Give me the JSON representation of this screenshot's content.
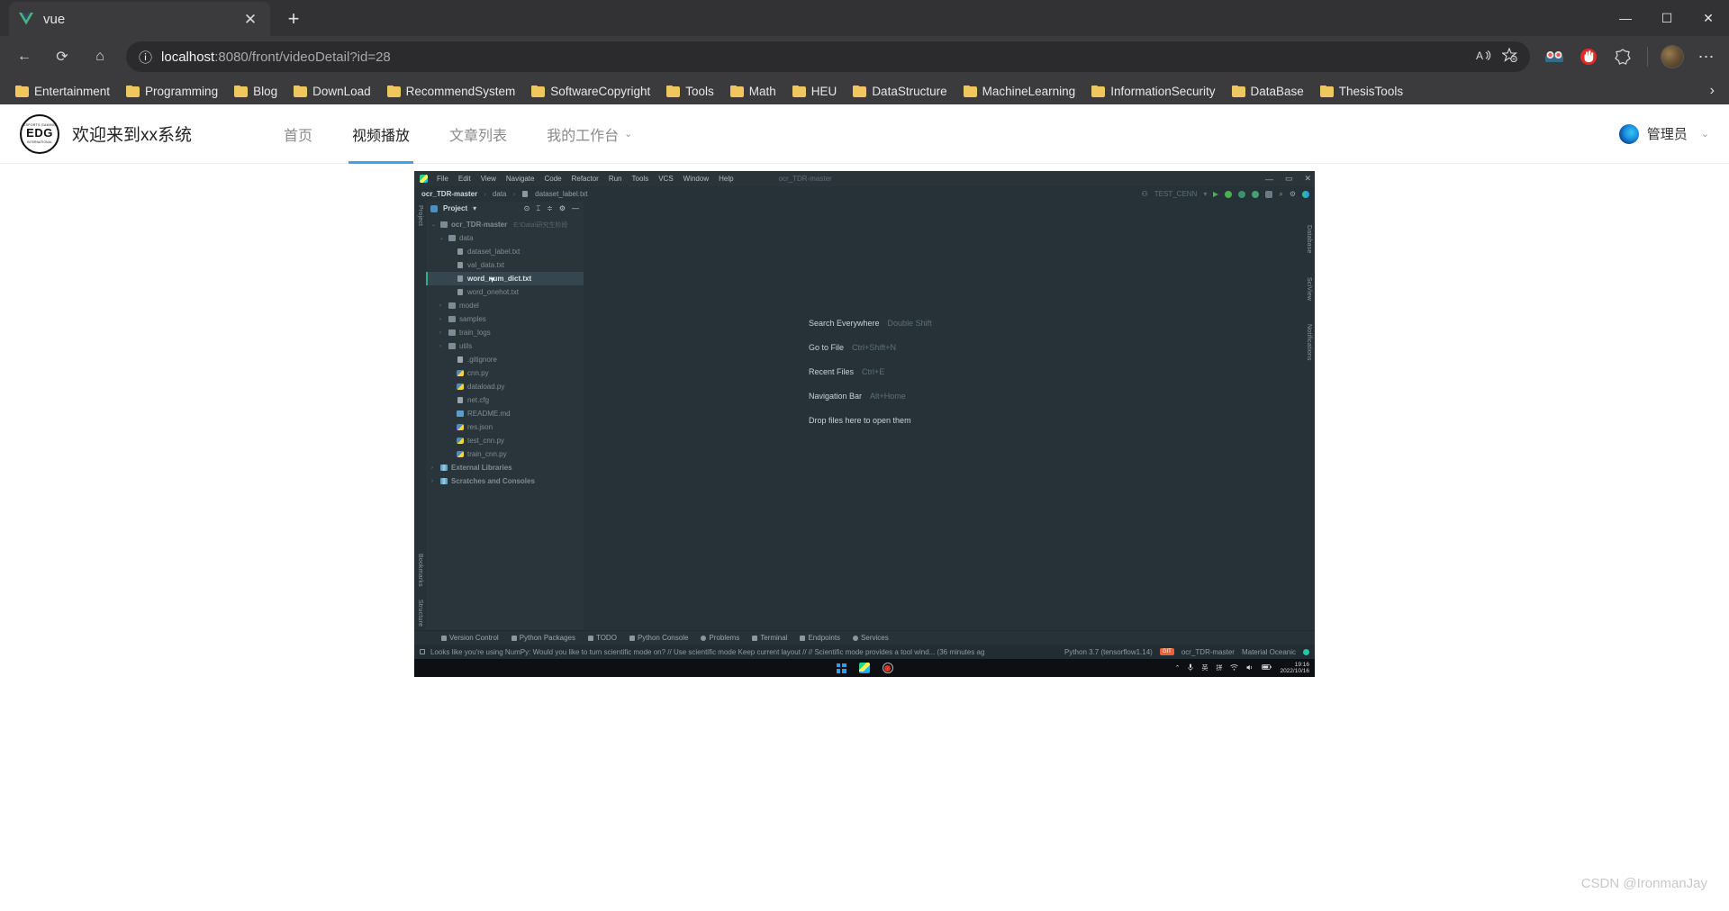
{
  "browser": {
    "tab": {
      "title": "vue",
      "favicon": "vue-logo-icon",
      "close_label": "✕"
    },
    "new_tab_label": "+",
    "window_controls": {
      "minimize": "—",
      "maximize": "☐",
      "close": "✕"
    },
    "nav": {
      "back": "←",
      "refresh": "⟳",
      "home": "⌂"
    },
    "omnibox": {
      "info_icon": "ⓘ",
      "url_host": "localhost",
      "url_path": ":8080/front/videoDetail?id=28",
      "read_aloud": "A",
      "favorite": "☆"
    },
    "toolbar_icons": [
      "glasses-extension-icon",
      "ublock-extension-icon",
      "collections-icon"
    ],
    "settings_more": "⋯",
    "bookmarks": [
      "Entertainment",
      "Programming",
      "Blog",
      "DownLoad",
      "RecommendSystem",
      "SoftwareCopyright",
      "Tools",
      "Math",
      "HEU",
      "DataStructure",
      "MachineLearning",
      "InformationSecurity",
      "DataBase",
      "ThesisTools"
    ],
    "bookmarks_overflow": "›"
  },
  "site": {
    "logo": {
      "top": "ESPORTS GAMING",
      "main": "EDG",
      "bottom": "INTERNATIONAL"
    },
    "title": "欢迎来到xx系统",
    "nav": [
      {
        "label": "首页",
        "active": false,
        "caret": ""
      },
      {
        "label": "视频播放",
        "active": true,
        "caret": ""
      },
      {
        "label": "文章列表",
        "active": false,
        "caret": ""
      },
      {
        "label": "我的工作台",
        "active": false,
        "caret": "⌄"
      }
    ],
    "user": {
      "name": "管理员",
      "caret": "⌄"
    }
  },
  "ide": {
    "app_icon": "pycharm-icon",
    "menus": [
      "File",
      "Edit",
      "View",
      "Navigate",
      "Code",
      "Refactor",
      "Run",
      "Tools",
      "VCS",
      "Window",
      "Help"
    ],
    "project_title": "ocr_TDR-master",
    "window_controls": {
      "minimize": "—",
      "maximize": "▭",
      "close": "✕"
    },
    "breadcrumb": {
      "root": "ocr_TDR-master",
      "sep": "›",
      "folder": "data",
      "file": "dataset_label.txt"
    },
    "toolbar": {
      "profile": "⚇",
      "run_config": "TEST_CENN",
      "dropdown": "▾",
      "run": "▶",
      "debug": "debug-icon",
      "coverage": "coverage-icon",
      "profile_run": "profiler-icon",
      "stop": "■",
      "search": "⌕",
      "settings": "⚙",
      "updates": "updates-icon"
    },
    "left_strip": {
      "top": "Project",
      "bookmarks": "Bookmarks",
      "structure": "Structure"
    },
    "right_strip": [
      "Database",
      "SciView",
      "Notifications"
    ],
    "panel": {
      "title": "Project",
      "dropdown": "▾",
      "icons": [
        "locate-icon",
        "collapse-icon",
        "sort-icon",
        "gear-icon",
        "hide-icon"
      ]
    },
    "tree": [
      {
        "depth": 0,
        "arrow": "⌄",
        "icon": "dir",
        "label": "ocr_TDR-master",
        "path": "E:\\Data\\研究生阶段",
        "selected": false
      },
      {
        "depth": 1,
        "arrow": "⌄",
        "icon": "dir",
        "label": "data",
        "path": "",
        "selected": false
      },
      {
        "depth": 2,
        "arrow": "",
        "icon": "txt",
        "label": "dataset_label.txt",
        "path": "",
        "selected": false
      },
      {
        "depth": 2,
        "arrow": "",
        "icon": "txt",
        "label": "val_data.txt",
        "path": "",
        "selected": false
      },
      {
        "depth": 2,
        "arrow": "",
        "icon": "txt",
        "label": "word_num_dict.txt",
        "path": "",
        "selected": true
      },
      {
        "depth": 2,
        "arrow": "",
        "icon": "txt",
        "label": "word_onehot.txt",
        "path": "",
        "selected": false
      },
      {
        "depth": 1,
        "arrow": "›",
        "icon": "dir",
        "label": "model",
        "path": "",
        "selected": false
      },
      {
        "depth": 1,
        "arrow": "›",
        "icon": "dir",
        "label": "samples",
        "path": "",
        "selected": false
      },
      {
        "depth": 1,
        "arrow": "›",
        "icon": "dir",
        "label": "train_logs",
        "path": "",
        "selected": false
      },
      {
        "depth": 1,
        "arrow": "›",
        "icon": "dir",
        "label": "utils",
        "path": "",
        "selected": false
      },
      {
        "depth": 2,
        "arrow": "",
        "icon": "cfg",
        "label": ".gitignore",
        "path": "",
        "selected": false
      },
      {
        "depth": 2,
        "arrow": "",
        "icon": "py",
        "label": "cnn.py",
        "path": "",
        "selected": false
      },
      {
        "depth": 2,
        "arrow": "",
        "icon": "py",
        "label": "dataload.py",
        "path": "",
        "selected": false
      },
      {
        "depth": 2,
        "arrow": "",
        "icon": "cfg",
        "label": "net.cfg",
        "path": "",
        "selected": false
      },
      {
        "depth": 2,
        "arrow": "",
        "icon": "md",
        "label": "README.md",
        "path": "",
        "selected": false
      },
      {
        "depth": 2,
        "arrow": "",
        "icon": "py",
        "label": "res.json",
        "path": "",
        "selected": false
      },
      {
        "depth": 2,
        "arrow": "",
        "icon": "py",
        "label": "test_cnn.py",
        "path": "",
        "selected": false
      },
      {
        "depth": 2,
        "arrow": "",
        "icon": "py",
        "label": "train_cnn.py",
        "path": "",
        "selected": false
      },
      {
        "depth": 0,
        "arrow": "›",
        "icon": "lib",
        "label": "External Libraries",
        "path": "",
        "selected": false
      },
      {
        "depth": 0,
        "arrow": "›",
        "icon": "lib",
        "label": "Scratches and Consoles",
        "path": "",
        "selected": false
      }
    ],
    "editor_hints": [
      {
        "key": "Search Everywhere",
        "shortcut": "Double Shift"
      },
      {
        "key": "Go to File",
        "shortcut": "Ctrl+Shift+N"
      },
      {
        "key": "Recent Files",
        "shortcut": "Ctrl+E"
      },
      {
        "key": "Navigation Bar",
        "shortcut": "Alt+Home"
      }
    ],
    "editor_drop_hint": "Drop files here to open them",
    "tool_windows": [
      "Version Control",
      "Python Packages",
      "TODO",
      "Python Console",
      "Problems",
      "Terminal",
      "Endpoints",
      "Services"
    ],
    "status_notification": "Looks like you're using NumPy: Would you like to turn scientific mode on? // Use scientific mode   Keep current layout // // Scientific mode provides a tool wind... (36 minutes ag",
    "status_right": {
      "interpreter": "Python 3.7 (tensorflow1.14)",
      "git_badge": "GIT",
      "branch": "ocr_TDR-master",
      "theme": "Material Oceanic"
    }
  },
  "taskbar": {
    "start": "windows-start-icon",
    "apps": [
      "pycharm-taskbar-icon",
      "screen-recorder-icon"
    ],
    "tray": {
      "chevron": "⌃",
      "mic": "mic-icon",
      "ime_lang": "英",
      "ime_mode": "拼",
      "wifi": "wifi-icon",
      "volume": "volume-icon",
      "battery": "battery-icon"
    },
    "clock": {
      "time": "19:16",
      "date": "2022/10/16"
    }
  },
  "watermark": "CSDN @IronmanJay"
}
